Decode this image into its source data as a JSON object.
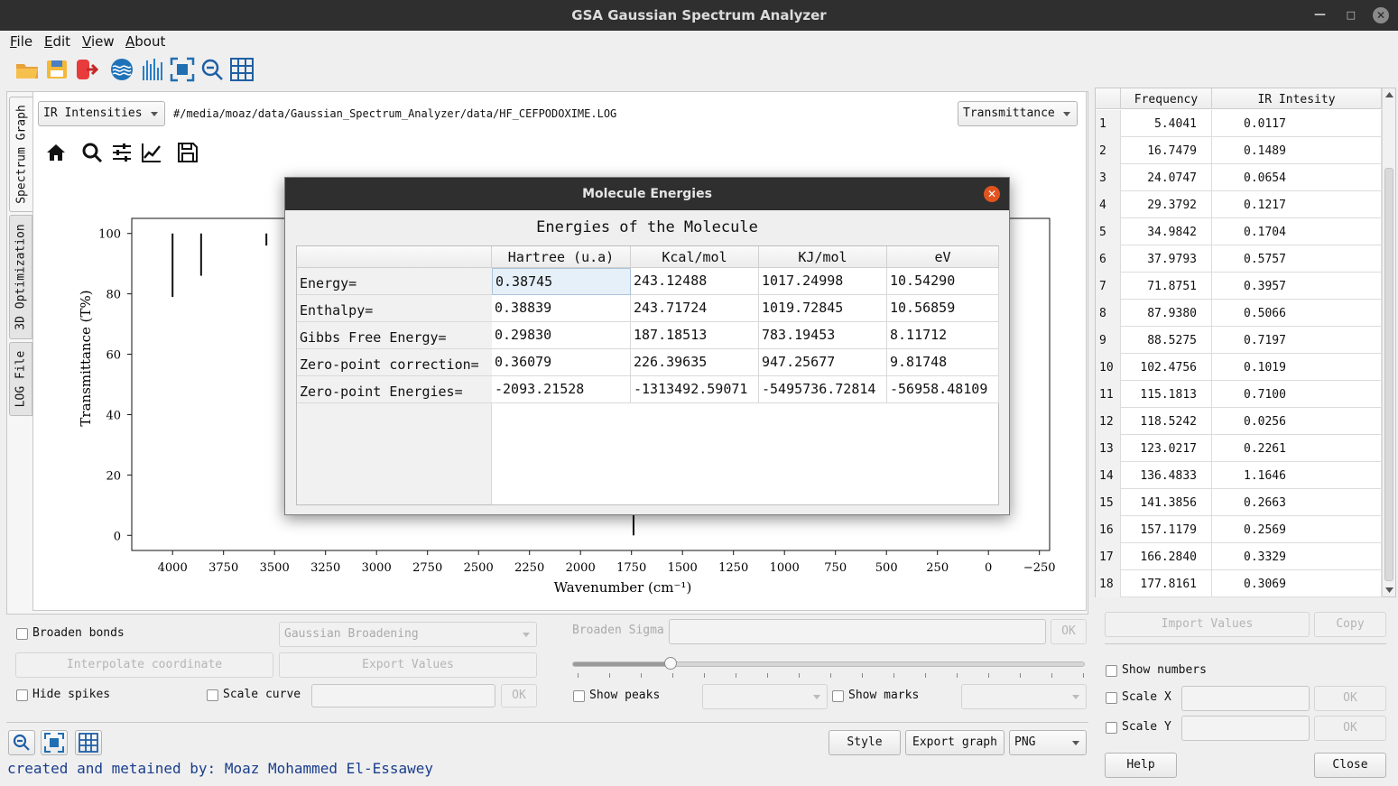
{
  "window": {
    "title": "GSA Gaussian Spectrum Analyzer"
  },
  "menu": [
    {
      "accel": "F",
      "rest": "ile"
    },
    {
      "accel": "E",
      "rest": "dit"
    },
    {
      "accel": "V",
      "rest": "iew"
    },
    {
      "accel": "A",
      "rest": "bout"
    }
  ],
  "toolbar": {
    "icons": [
      "open-folder-icon",
      "save-icon",
      "exit-icon",
      "broaden-wave-icon",
      "spectrum-bars-icon",
      "fit-view-icon",
      "zoom-out-icon",
      "grid-icon"
    ]
  },
  "tabs": [
    "Spectrum Graph",
    "3D Optimization",
    "LOG File"
  ],
  "spectrum_combo": "IR Intensities",
  "file_path": "#/media/moaz/data/Gaussian_Spectrum_Analyzer/data/HF_CEFPODOXIME.LOG",
  "mode_combo": "Transmittance",
  "plot_tools": [
    "home-icon",
    "magnify-icon",
    "sliders-icon",
    "trend-icon",
    "floppy-icon"
  ],
  "chart_data": {
    "type": "bar",
    "xlabel": "Wavenumber (cm⁻¹)",
    "ylabel": "Transmittance (T%)",
    "xlim": [
      4200,
      -300
    ],
    "ylim": [
      -5,
      105
    ],
    "x_ticks": [
      "4000",
      "3750",
      "3500",
      "3250",
      "3000",
      "2750",
      "2500",
      "2250",
      "2000",
      "1750",
      "1500",
      "1250",
      "1000",
      "750",
      "500",
      "250",
      "0",
      "−250"
    ],
    "y_ticks": [
      "0",
      "20",
      "40",
      "60",
      "80",
      "100"
    ],
    "tick_values_x": [
      4000,
      3750,
      3500,
      3250,
      3000,
      2750,
      2500,
      2250,
      2000,
      1750,
      1500,
      1250,
      1000,
      750,
      500,
      250,
      0,
      -250
    ],
    "tick_values_y": [
      0,
      20,
      40,
      60,
      80,
      100
    ],
    "visible_lines": [
      {
        "x": 4000,
        "y_top": 100,
        "y_bottom": 79
      },
      {
        "x": 3860,
        "y_top": 100,
        "y_bottom": 86
      },
      {
        "x": 3540,
        "y_top": 100,
        "y_bottom": 96
      },
      {
        "x": 1740,
        "y_top": 7,
        "y_bottom": 0
      }
    ]
  },
  "dialog": {
    "title": "Molecule Energies",
    "heading": "Energies of the Molecule",
    "columns": [
      "Hartree (u.a)",
      "Kcal/mol",
      "KJ/mol",
      "eV"
    ],
    "rows": [
      {
        "label": "Energy=",
        "values": [
          "0.38745",
          "243.12488",
          "1017.24998",
          "10.54290"
        ]
      },
      {
        "label": "Enthalpy=",
        "values": [
          "0.38839",
          "243.71724",
          "1019.72845",
          "10.56859"
        ]
      },
      {
        "label": "Gibbs Free Energy=",
        "values": [
          "0.29830",
          "187.18513",
          "783.19453",
          "8.11712"
        ]
      },
      {
        "label": "Zero-point correction=",
        "values": [
          "0.36079",
          "226.39635",
          "947.25677",
          "9.81748"
        ]
      },
      {
        "label": "Zero-point Energies=",
        "values": [
          "-2093.21528",
          "-1313492.59071",
          "-5495736.72814",
          "-56958.48109"
        ]
      }
    ]
  },
  "freq_table": {
    "columns": [
      "Frequency",
      "IR Intesity"
    ],
    "rows": [
      [
        "1",
        "5.4041",
        "0.0117"
      ],
      [
        "2",
        "16.7479",
        "0.1489"
      ],
      [
        "3",
        "24.0747",
        "0.0654"
      ],
      [
        "4",
        "29.3792",
        "0.1217"
      ],
      [
        "5",
        "34.9842",
        "0.1704"
      ],
      [
        "6",
        "37.9793",
        "0.5757"
      ],
      [
        "7",
        "71.8751",
        "0.3957"
      ],
      [
        "8",
        "87.9380",
        "0.5066"
      ],
      [
        "9",
        "88.5275",
        "0.7197"
      ],
      [
        "10",
        "102.4756",
        "0.1019"
      ],
      [
        "11",
        "115.1813",
        "0.7100"
      ],
      [
        "12",
        "118.5242",
        "0.0256"
      ],
      [
        "13",
        "123.0217",
        "0.2261"
      ],
      [
        "14",
        "136.4833",
        "1.1646"
      ],
      [
        "15",
        "141.3856",
        "0.2663"
      ],
      [
        "16",
        "157.1179",
        "0.2569"
      ],
      [
        "17",
        "166.2840",
        "0.3329"
      ],
      [
        "18",
        "177.8161",
        "0.3069"
      ]
    ]
  },
  "controls": {
    "broaden_bonds": "Broaden bonds",
    "broadening_combo": "Gaussian Broadening",
    "broaden_sigma": "Broaden Sigma",
    "ok": "OK",
    "interpolate": "Interpolate coordinate",
    "export_values": "Export Values",
    "hide_spikes": "Hide spikes",
    "scale_curve": "Scale curve",
    "show_peaks": "Show peaks",
    "show_marks": "Show marks",
    "slider_value": 0.19
  },
  "right_controls": {
    "import_values": "Import Values",
    "copy": "Copy",
    "show_numbers": "Show numbers",
    "scale_x": "Scale X",
    "scale_y": "Scale Y",
    "ok": "OK",
    "help": "Help",
    "close": "Close"
  },
  "bottom": {
    "style": "Style",
    "export_graph": "Export graph",
    "format": "PNG",
    "credit": "created and metained by: Moaz Mohammed El-Essawey"
  }
}
